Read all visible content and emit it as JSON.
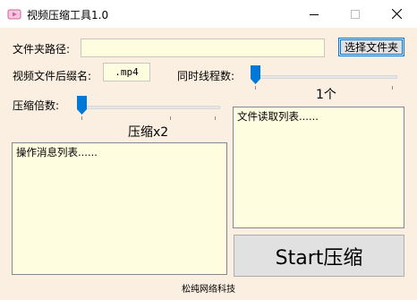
{
  "window": {
    "title": "视频压缩工具1.0",
    "icon": "app-video-icon",
    "controls": [
      "minimize-icon",
      "maximize-icon",
      "close-icon"
    ]
  },
  "form": {
    "folder_path_label": "文件夹路径:",
    "folder_path_value": "",
    "choose_folder_button": "选择文件夹",
    "extension_label": "视频文件后缀名:",
    "extension_value": ".mp4",
    "threads_label": "同时线程数:",
    "threads_level": 0,
    "threads_value_label": "1个",
    "compress_label": "压缩倍数:",
    "compress_level": 0,
    "compress_value_label": "压缩x2"
  },
  "lists": {
    "messages_title": "操作消息列表......",
    "files_title": "文件读取列表......"
  },
  "actions": {
    "start_button": "Start压缩"
  },
  "footer": {
    "company": "松纯网络科技"
  },
  "colors": {
    "background": "#fbefe1",
    "input_background": "#fffde0",
    "slider_thumb": "#0078d7",
    "button_border_focus": "#0078d7"
  }
}
